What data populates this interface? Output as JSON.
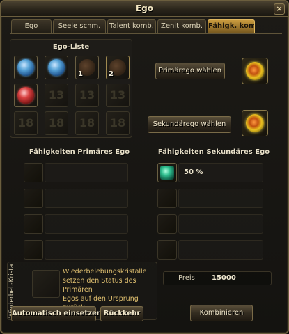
{
  "window": {
    "title": "Ego",
    "close_label": "×"
  },
  "tabs": [
    {
      "label": "Ego",
      "active": false
    },
    {
      "label": "Seele schm.",
      "active": false
    },
    {
      "label": "Talent komb.",
      "active": false
    },
    {
      "label": "Zenit komb.",
      "active": false
    },
    {
      "label": "Fähigk. komb.",
      "active": true
    }
  ],
  "ego_list": {
    "title": "Ego-Liste",
    "slots": [
      {
        "icon": "blue-ego-icon",
        "number": ""
      },
      {
        "icon": "blue-ego-icon",
        "number": ""
      },
      {
        "icon": "brown-ego-icon",
        "number": "1"
      },
      {
        "icon": "brown-ego-icon",
        "number": "2"
      },
      {
        "icon": "red-ego-icon",
        "number": ""
      },
      {
        "level": "13"
      },
      {
        "level": "13"
      },
      {
        "level": "13"
      },
      {
        "level": "18"
      },
      {
        "level": "18"
      },
      {
        "level": "18"
      },
      {
        "level": "18"
      }
    ]
  },
  "primary": {
    "button_label": "Primärego wählen"
  },
  "secondary": {
    "button_label": "Sekundärego wählen"
  },
  "abilities_primary": {
    "title": "Fähigkeiten Primäres Ego"
  },
  "abilities_secondary": {
    "title": "Fähigkeiten Sekundäres Ego",
    "rows": [
      {
        "value": "50 %",
        "icon": "ability-icon"
      }
    ]
  },
  "crystal": {
    "vertical_label": "Wiederbel.-Kristall",
    "description_lines": [
      "Wiederbelebungskristalle",
      "setzen den Status des Primären",
      "Egos auf den Ursprung zurück."
    ],
    "auto_button": "Automatisch einsetzen",
    "back_button": "Rückkehr"
  },
  "price": {
    "label": "Preis",
    "value": "15000"
  },
  "combine_button": "Kombinieren",
  "colors": {
    "accent": "#c89a3e",
    "border": "#6b5e3e",
    "text": "#e8e0c8",
    "desc_text": "#e0c070"
  }
}
